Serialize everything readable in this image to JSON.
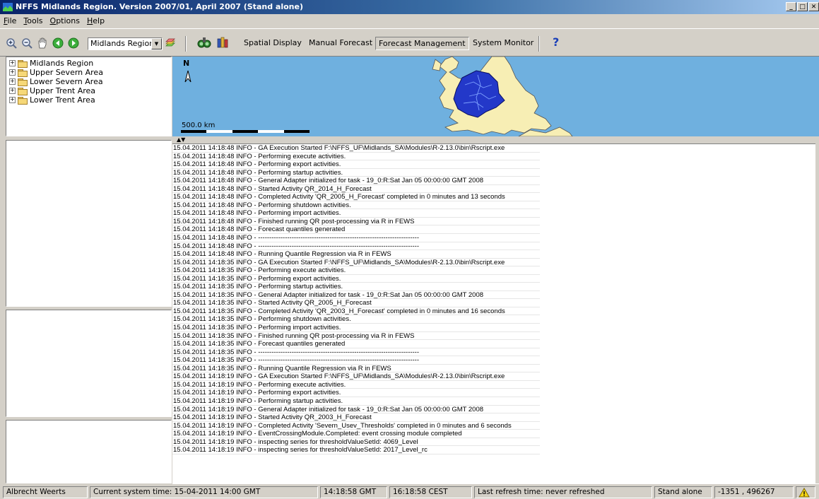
{
  "window": {
    "title": "NFFS Midlands Region. Version 2007/01, April 2007 (Stand alone)",
    "buttons": [
      "_",
      "□",
      "✕"
    ]
  },
  "menu": {
    "items": [
      {
        "label": "File",
        "accel": "F"
      },
      {
        "label": "Tools",
        "accel": "T"
      },
      {
        "label": "Options",
        "accel": "O"
      },
      {
        "label": "Help",
        "accel": "H"
      }
    ]
  },
  "toolbar": {
    "icons": [
      "zoom-in-icon",
      "zoom-out-icon",
      "pan-hand-icon",
      "back-arrow-icon",
      "forward-arrow-icon"
    ],
    "region_select": "Midlands Region",
    "buttons": {
      "spatial_display": "Spatial Display",
      "manual_forecast": "Manual Forecast",
      "forecast_management": "Forecast Management",
      "system_monitor": "System Monitor",
      "help": "?"
    }
  },
  "tree": {
    "items": [
      "Midlands Region",
      "Upper Severn Area",
      "Lower Severn Area",
      "Upper Trent Area",
      "Lower Trent Area"
    ],
    "expander": "+"
  },
  "map": {
    "north_label": "N",
    "scale_label": "500.0 km",
    "colors": {
      "sea": "#6fb0df",
      "land": "#f7eeb4",
      "catchment": "#2338c9"
    }
  },
  "log": {
    "lines": [
      "15.04.2011 14:18:48 INFO - GA Execution Started F:\\NFFS_UF\\Midlands_SA\\Modules\\R-2.13.0\\bin\\Rscript.exe",
      "15.04.2011 14:18:48 INFO - Performing execute activities.",
      "15.04.2011 14:18:48 INFO - Performing export activities.",
      "15.04.2011 14:18:48 INFO - Performing startup activities.",
      "15.04.2011 14:18:48 INFO - General Adapter initialized for task - 19_0:R:Sat Jan 05 00:00:00 GMT 2008",
      "15.04.2011 14:18:48 INFO - Started Activity QR_2014_H_Forecast",
      "15.04.2011 14:18:48 INFO - Completed Activity 'QR_2005_H_Forecast' completed in 0 minutes and 13 seconds",
      "15.04.2011 14:18:48 INFO - Performing shutdown activities.",
      "15.04.2011 14:18:48 INFO - Performing import activities.",
      "15.04.2011 14:18:48 INFO - Finished running QR post-processing via R in FEWS",
      "15.04.2011 14:18:48 INFO - Forecast quantiles generated",
      "15.04.2011 14:18:48 INFO - ------------------------------------------------------------------------",
      "15.04.2011 14:18:48 INFO - ------------------------------------------------------------------------",
      "15.04.2011 14:18:48 INFO - Running Quantile Regression via R in FEWS",
      "15.04.2011 14:18:35 INFO - GA Execution Started F:\\NFFS_UF\\Midlands_SA\\Modules\\R-2.13.0\\bin\\Rscript.exe",
      "15.04.2011 14:18:35 INFO - Performing execute activities.",
      "15.04.2011 14:18:35 INFO - Performing export activities.",
      "15.04.2011 14:18:35 INFO - Performing startup activities.",
      "15.04.2011 14:18:35 INFO - General Adapter initialized for task - 19_0:R:Sat Jan 05 00:00:00 GMT 2008",
      "15.04.2011 14:18:35 INFO - Started Activity QR_2005_H_Forecast",
      "15.04.2011 14:18:35 INFO - Completed Activity 'QR_2003_H_Forecast' completed in 0 minutes and 16 seconds",
      "15.04.2011 14:18:35 INFO - Performing shutdown activities.",
      "15.04.2011 14:18:35 INFO - Performing import activities.",
      "15.04.2011 14:18:35 INFO - Finished running QR post-processing via R in FEWS",
      "15.04.2011 14:18:35 INFO - Forecast quantiles generated",
      "15.04.2011 14:18:35 INFO - ------------------------------------------------------------------------",
      "15.04.2011 14:18:35 INFO - ------------------------------------------------------------------------",
      "15.04.2011 14:18:35 INFO - Running Quantile Regression via R in FEWS",
      "15.04.2011 14:18:19 INFO - GA Execution Started F:\\NFFS_UF\\Midlands_SA\\Modules\\R-2.13.0\\bin\\Rscript.exe",
      "15.04.2011 14:18:19 INFO - Performing execute activities.",
      "15.04.2011 14:18:19 INFO - Performing export activities.",
      "15.04.2011 14:18:19 INFO - Performing startup activities.",
      "15.04.2011 14:18:19 INFO - General Adapter initialized for task - 19_0:R:Sat Jan 05 00:00:00 GMT 2008",
      "15.04.2011 14:18:19 INFO - Started Activity QR_2003_H_Forecast",
      "15.04.2011 14:18:19 INFO - Completed Activity 'Severn_Usev_Thresholds' completed in 0 minutes and 6 seconds",
      "15.04.2011 14:18:19 INFO - EventCrossingModule.Completed: event crossing module completed",
      "15.04.2011 14:18:19 INFO - inspecting series for thresholdValueSetId: 4069_Level",
      "15.04.2011 14:18:19 INFO - inspecting series for thresholdValueSetId: 2017_Level_rc"
    ]
  },
  "status": {
    "user": "Albrecht Weerts",
    "system_time": "Current system time: 15-04-2011 14:00 GMT",
    "gmt_time": "14:18:58 GMT",
    "cest_time": "16:18:58 CEST",
    "refresh": "Last refresh time: never refreshed",
    "mode": "Stand alone",
    "coords": "-1351 , 496267"
  }
}
